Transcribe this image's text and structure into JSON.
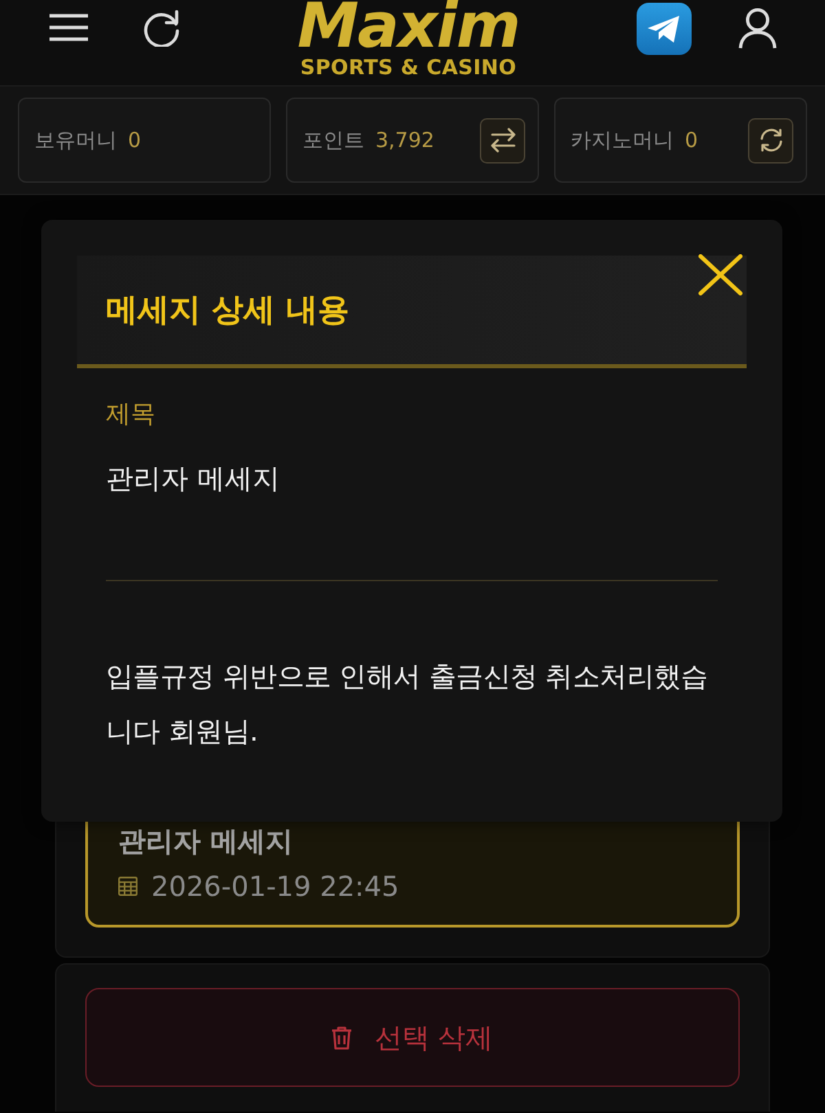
{
  "header": {
    "logo": {
      "title": "Maxim",
      "subtitle": "SPORTS & CASINO"
    }
  },
  "balances": [
    {
      "label": "보유머니",
      "value": "0",
      "kind": "plain"
    },
    {
      "label": "포인트",
      "value": "3,792",
      "kind": "exchange"
    },
    {
      "label": "카지노머니",
      "value": "0",
      "kind": "refresh"
    }
  ],
  "messages": [
    {
      "title": "관리자 메세지",
      "date": "2026-01-19 22:45",
      "selected": true
    }
  ],
  "delete_button": {
    "label": "선택 삭제"
  },
  "modal": {
    "title": "메세지 상세 내용",
    "subject_label": "제목",
    "subject": "관리자 메세지",
    "body": "입플규정 위반으로 인해서 출금신청 취소처리했습니다 회원님."
  }
}
